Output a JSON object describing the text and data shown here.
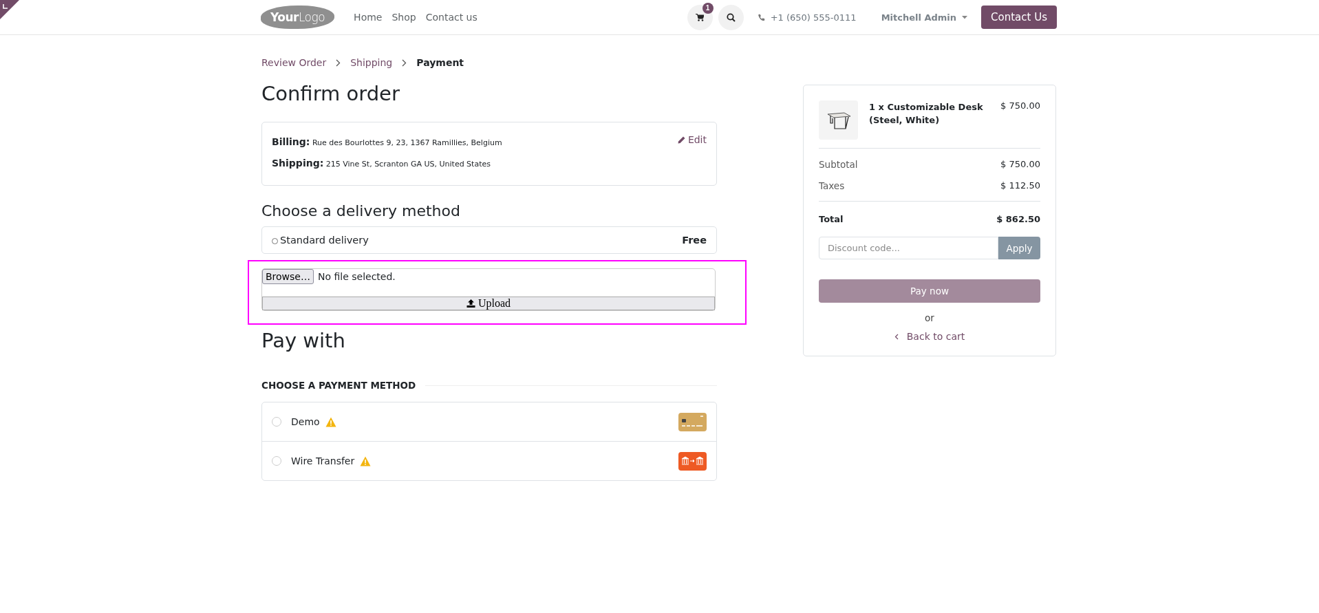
{
  "header": {
    "logo": {
      "bold": "Your",
      "light": "Logo"
    },
    "nav": [
      {
        "label": "Home"
      },
      {
        "label": "Shop"
      },
      {
        "label": "Contact us"
      }
    ],
    "cart_count": "1",
    "phone": "+1 (650) 555-0111",
    "user": "Mitchell Admin",
    "cta": "Contact Us"
  },
  "breadcrumbs": [
    {
      "label": "Review Order",
      "selected": false
    },
    {
      "label": "Shipping",
      "selected": false
    },
    {
      "label": "Payment",
      "selected": true
    }
  ],
  "title": "Confirm order",
  "addresses": [
    {
      "label": "Billing:",
      "value": "Rue des Bourlottes 9, 23, 1367 Ramillies, Belgium"
    },
    {
      "label": "Shipping:",
      "value": "215 Vine St, Scranton GA US, United States"
    }
  ],
  "edit_link": "Edit",
  "delivery": {
    "heading": "Choose a delivery method",
    "methods": [
      {
        "label": "Standard delivery",
        "price": "Free",
        "selected": false
      }
    ]
  },
  "upload": {
    "browse": "Browse…",
    "status": "No file selected.",
    "button": "Upload"
  },
  "payment": {
    "heading": "Pay with",
    "subheading": "CHOOSE A PAYMENT METHOD",
    "methods": [
      {
        "label": "Demo",
        "kind": "card",
        "warning": true,
        "selected": false
      },
      {
        "label": "Wire Transfer",
        "kind": "bank",
        "warning": true,
        "selected": false
      }
    ]
  },
  "summary": {
    "item": {
      "name": "1 x Customizable Desk (Steel, White)",
      "price": "$ 750.00"
    },
    "lines": [
      {
        "label": "Subtotal",
        "value": "$ 750.00"
      },
      {
        "label": "Taxes",
        "value": "$ 112.50"
      }
    ],
    "total": {
      "label": "Total",
      "value": "$ 862.50"
    },
    "discount": {
      "placeholder": "Discount code...",
      "button": "Apply"
    },
    "pay_button": "Pay now",
    "or": "or",
    "back": "Back to cart"
  }
}
